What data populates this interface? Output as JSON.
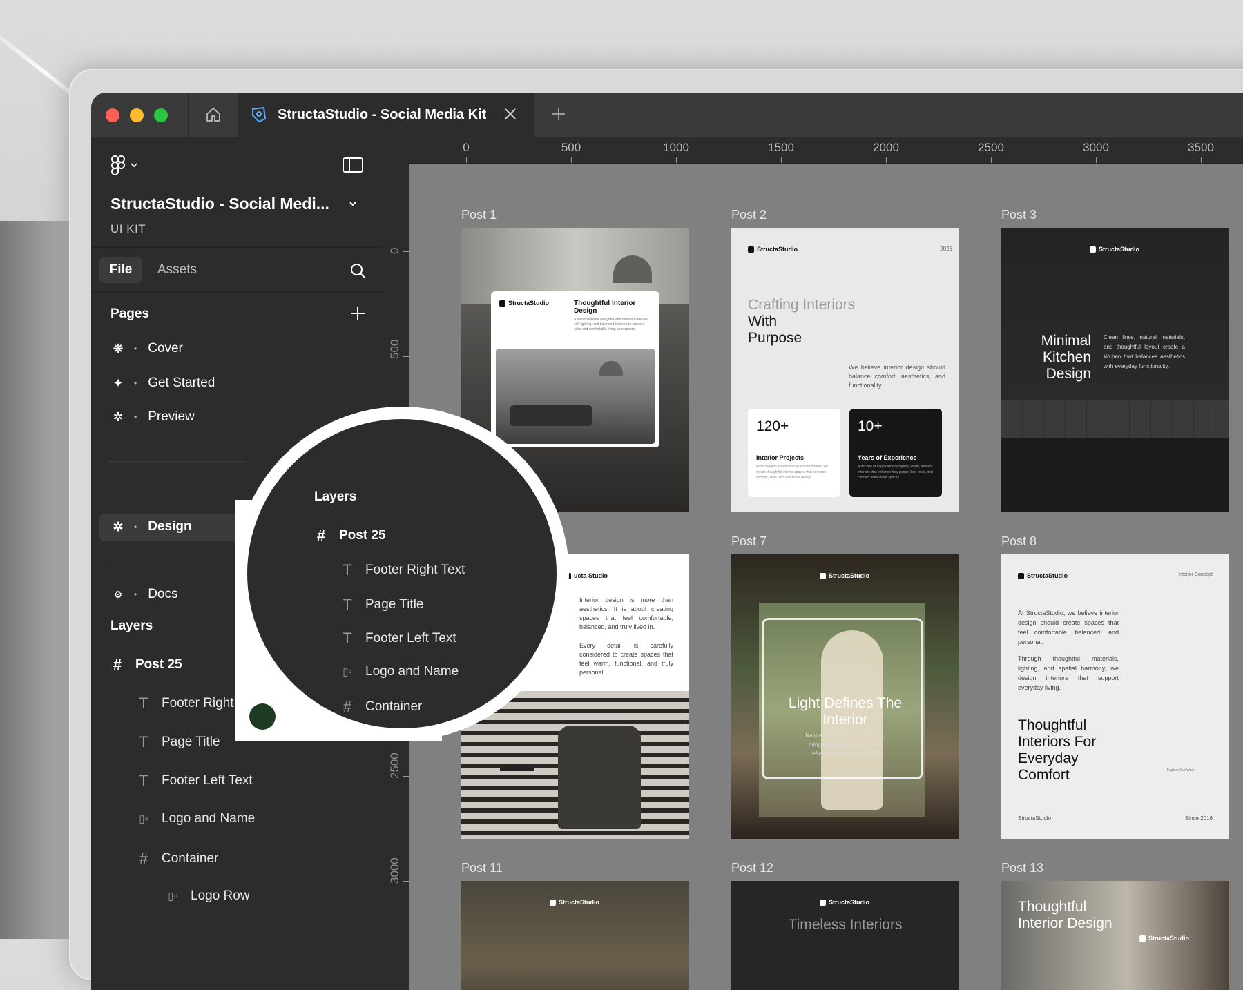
{
  "tabbar": {
    "file_tab_title": "StructaStudio - Social Media Kit"
  },
  "sidebar": {
    "file_name": "StructaStudio - Social Medi...",
    "file_subtitle": "UI KIT",
    "tabs": {
      "file": "File",
      "assets": "Assets"
    },
    "pages_heading": "Pages",
    "pages": [
      {
        "icon": "❋",
        "label": "Cover"
      },
      {
        "icon": "✦",
        "label": "Get Started"
      },
      {
        "icon": "✲",
        "label": "Preview"
      },
      {
        "icon": "✲",
        "label": "Design"
      },
      {
        "icon": "⚙",
        "label": "Docs"
      }
    ],
    "layers_heading": "Layers",
    "layers": [
      {
        "icon": "#",
        "label": "Post 25"
      },
      {
        "icon": "T",
        "label": "Footer Right Text"
      },
      {
        "icon": "T",
        "label": "Page Title"
      },
      {
        "icon": "T",
        "label": "Footer Left Text"
      },
      {
        "icon": "▯▫",
        "label": "Logo and Name"
      },
      {
        "icon": "#",
        "label": "Container"
      },
      {
        "icon": "▯▫",
        "label": "Logo Row"
      }
    ]
  },
  "ruler": {
    "top": [
      "0",
      "500",
      "1000",
      "1500",
      "2000",
      "2500",
      "3000",
      "3500"
    ],
    "left": [
      "0",
      "500",
      "2500",
      "3000"
    ]
  },
  "magnifier": {
    "heading": "Layers",
    "items": [
      {
        "icon": "#",
        "label": "Post 25"
      },
      {
        "icon": "T",
        "label": "Footer Right Text"
      },
      {
        "icon": "T",
        "label": "Page Title"
      },
      {
        "icon": "T",
        "label": "Footer Left Text"
      },
      {
        "icon": "▯▫",
        "label": "Logo and Name"
      },
      {
        "icon": "#",
        "label": "Container"
      }
    ]
  },
  "frames": {
    "post1": {
      "label": "Post 1",
      "brand": "StructaStudio",
      "heading": "Thoughtful Interior Design",
      "body": "A refined interior designed with natural materials, soft lighting, and balanced textures to create a calm and comfortable living atmosphere."
    },
    "post2": {
      "label": "Post 2",
      "brand": "StructaStudio",
      "year": "2026",
      "title_light": "Crafting Interiors",
      "title_bold1": "With",
      "title_bold2": "Purpose",
      "body": "We believe interior design should balance comfort, aesthetics, and functionality.",
      "stat1_value": "120+",
      "stat1_label": "Interior Projects",
      "stat1_body": "From modern apartments to private homes, we create thoughtful interior spaces that combine comfort, style, and functional design.",
      "stat2_value": "10+",
      "stat2_label": "Years of Experience",
      "stat2_body": "A decade of experience designing warm, modern interiors that enhance how people live, relax, and connect within their spaces."
    },
    "post3": {
      "label": "Post 3",
      "brand": "StructaStudio",
      "title": "Minimal Kitchen Design",
      "body": "Clean lines, natural materials, and thoughtful layout create a kitchen that balances aesthetics with everyday functionality."
    },
    "post6": {
      "brand": "ucta Studio",
      "body1": "Interior design is more than aesthetics. It is about creating spaces that feel comfortable, balanced, and truly lived in.",
      "body2": "Every detail is carefully considered to create spaces that feel warm, functional, and truly personal."
    },
    "post7": {
      "label": "Post 7",
      "brand": "StructaStudio",
      "title": "Light Defines The Interior",
      "body": "Natural light transforms interiors, bringing warmth, clarity, and a refreshing start to every day."
    },
    "post8": {
      "label": "Post 8",
      "brand": "StructaStudio",
      "tag": "Interior Concept",
      "body1": "At StructaStudio, we believe interior design should create spaces that feel comfortable, balanced, and personal.",
      "body2": "Through thoughtful materials, lighting, and spatial harmony, we design interiors that support everyday living.",
      "title": "Thoughtful Interiors For Everyday Comfort",
      "cta": "Explore Our Work",
      "footer_left": "StructaStudio",
      "footer_right": "Since 2016"
    },
    "post11": {
      "label": "Post 11",
      "brand": "StructaStudio"
    },
    "post12": {
      "label": "Post 12",
      "brand": "StructaStudio",
      "title": "Timeless Interiors"
    },
    "post13": {
      "label": "Post 13",
      "title": "Thoughtful Interior Design",
      "brand": "StructaStudio"
    }
  }
}
